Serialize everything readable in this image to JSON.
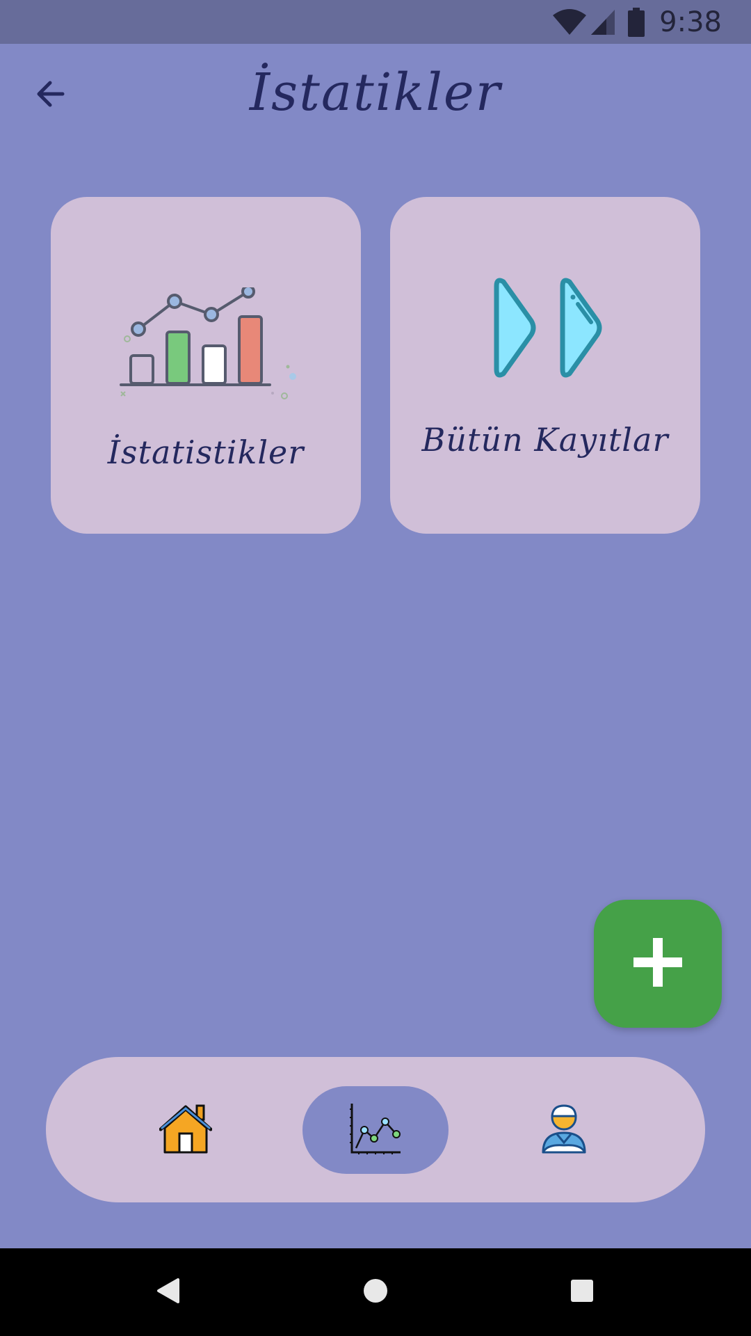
{
  "status_bar": {
    "time": "9:38",
    "icons": [
      "wifi-icon",
      "signal-icon",
      "battery-icon"
    ]
  },
  "header": {
    "title": "İstatikler",
    "back_icon": "arrow-left-icon"
  },
  "cards": [
    {
      "label": "İstatistikler",
      "icon": "bar-line-chart-icon"
    },
    {
      "label": "Bütün Kayıtlar",
      "icon": "fast-forward-icon"
    }
  ],
  "fab": {
    "icon": "plus-icon",
    "color": "#45a148"
  },
  "bottom_nav": {
    "items": [
      {
        "icon": "home-icon",
        "selected": false
      },
      {
        "icon": "line-chart-icon",
        "selected": true
      },
      {
        "icon": "profile-icon",
        "selected": false
      }
    ]
  },
  "system_nav": {
    "icons": [
      "back-triangle-icon",
      "home-circle-icon",
      "recents-square-icon"
    ]
  },
  "colors": {
    "background": "#8289c6",
    "status_bar": "#676c9a",
    "card": "#d0bfd8",
    "title_text": "#24285e",
    "fab": "#45a148"
  }
}
